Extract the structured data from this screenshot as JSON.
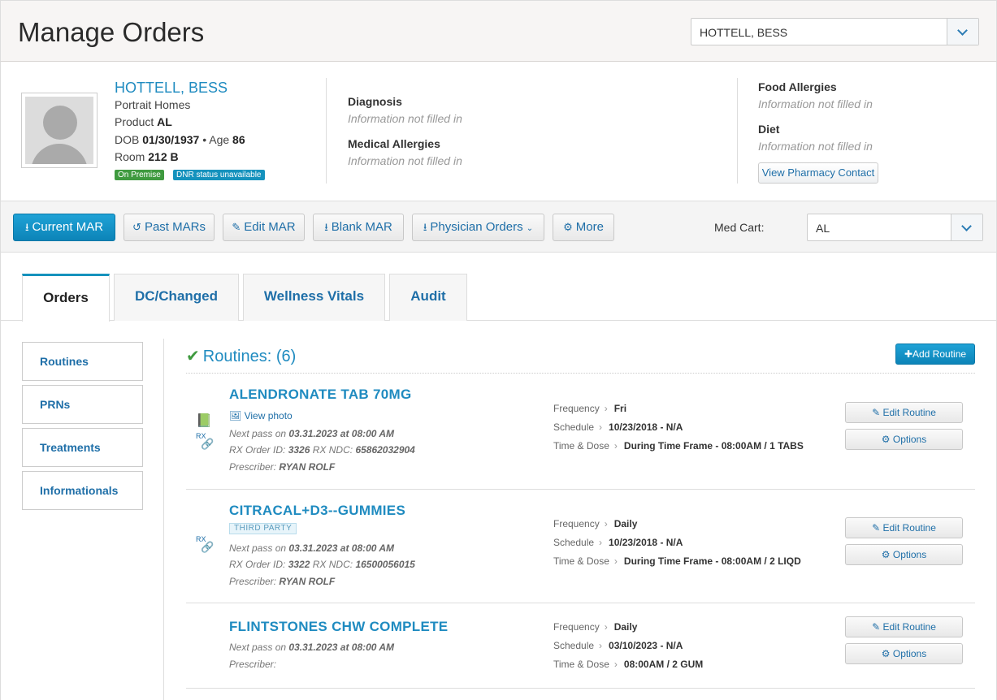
{
  "header": {
    "title": "Manage Orders",
    "resident_select": "HOTTELL, BESS"
  },
  "patient": {
    "name": "HOTTELL, BESS",
    "facility": "Portrait Homes",
    "product_label": "Product",
    "product": "AL",
    "dob_label": "DOB",
    "dob": "01/30/1937",
    "age_label": "Age",
    "age": "86",
    "room_label": "Room",
    "room": "212 B",
    "badge_premise": "On Premise",
    "badge_dnr": "DNR status unavailable"
  },
  "info": {
    "diagnosis_label": "Diagnosis",
    "diagnosis_value": "Information not filled in",
    "medical_allergies_label": "Medical Allergies",
    "medical_allergies_value": "Information not filled in",
    "food_allergies_label": "Food Allergies",
    "food_allergies_value": "Information not filled in",
    "diet_label": "Diet",
    "diet_value": "Information not filled in",
    "pharmacy_button": "View Pharmacy Contact"
  },
  "toolbar": {
    "current_mar": "Current MAR",
    "past_mars": "Past MARs",
    "edit_mar": "Edit MAR",
    "blank_mar": "Blank MAR",
    "physician_orders": "Physician Orders",
    "more": "More",
    "med_cart_label": "Med Cart:",
    "med_cart_value": "AL"
  },
  "tabs": [
    "Orders",
    "DC/Changed",
    "Wellness Vitals",
    "Audit"
  ],
  "sidebar": [
    "Routines",
    "PRNs",
    "Treatments",
    "Informationals"
  ],
  "routines": {
    "title": "Routines: (6)",
    "add_button": "Add Routine",
    "edit_button": "Edit Routine",
    "options_button": "Options",
    "frequency_label": "Frequency",
    "schedule_label": "Schedule",
    "time_dose_label": "Time & Dose",
    "view_photo": "View photo",
    "third_party": "THIRD PARTY",
    "rx_label": "RX",
    "orders": [
      {
        "name": "ALENDRONATE TAB 70MG",
        "next_pass_prefix": "Next pass on",
        "next_pass": "03.31.2023 at 08:00 AM",
        "rx_line_prefix": "RX Order ID:",
        "rx_order_id": "3326",
        "ndc_prefix": "RX NDC:",
        "ndc": "65862032904",
        "prescriber_prefix": "Prescriber:",
        "prescriber": "RYAN ROLF",
        "frequency": "Fri",
        "schedule": "10/23/2018 - N/A",
        "time_dose": "During Time Frame - 08:00AM / 1 TABS"
      },
      {
        "name": "CITRACAL+D3--GUMMIES",
        "next_pass_prefix": "Next pass on",
        "next_pass": "03.31.2023 at 08:00 AM",
        "rx_line_prefix": "RX Order ID:",
        "rx_order_id": "3322",
        "ndc_prefix": "RX NDC:",
        "ndc": "16500056015",
        "prescriber_prefix": "Prescriber:",
        "prescriber": "RYAN ROLF",
        "frequency": "Daily",
        "schedule": "10/23/2018 - N/A",
        "time_dose": "During Time Frame - 08:00AM / 2 LIQD"
      },
      {
        "name": "FLINTSTONES CHW COMPLETE",
        "next_pass_prefix": "Next pass on",
        "next_pass": "03.31.2023 at 08:00 AM",
        "prescriber_prefix": "Prescriber:",
        "frequency": "Daily",
        "schedule": "03/10/2023 - N/A",
        "time_dose": "08:00AM / 2 GUM"
      }
    ]
  }
}
